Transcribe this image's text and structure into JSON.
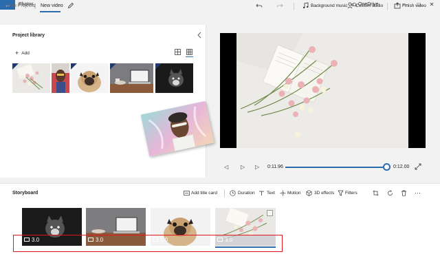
{
  "window": {
    "title": "Photos",
    "onedrive_label": "OneDrive",
    "controls": [
      "—",
      "□",
      "✕"
    ]
  },
  "toolbar": {
    "breadcrumb_root": "Video Projects",
    "breadcrumb_separator": "|",
    "breadcrumb_current": "New video",
    "background_music_label": "Background music",
    "custom_audio_label": "Custom audio",
    "finish_video_label": "Finish video"
  },
  "library": {
    "title": "Project library",
    "add_label": "Add"
  },
  "player": {
    "current_time": "0:11.96",
    "total_time": "0:12.00",
    "progress": 0.997
  },
  "storyboard": {
    "title": "Storyboard",
    "add_title_card_label": "Add title card",
    "duration_label": "Duration",
    "text_label": "Text",
    "motion_label": "Motion",
    "effects_label": "3D effects",
    "filters_label": "Filters",
    "cards": [
      {
        "duration": "3.0",
        "subject": "black cat"
      },
      {
        "duration": "3.0",
        "subject": "laptop on desk"
      },
      {
        "duration": "3.0",
        "subject": "pug dog"
      },
      {
        "duration": "3.0",
        "subject": "flowers on book",
        "selected": true
      }
    ]
  },
  "colors": {
    "accent": "#2b6cb0",
    "highlight": "#e0161b"
  }
}
